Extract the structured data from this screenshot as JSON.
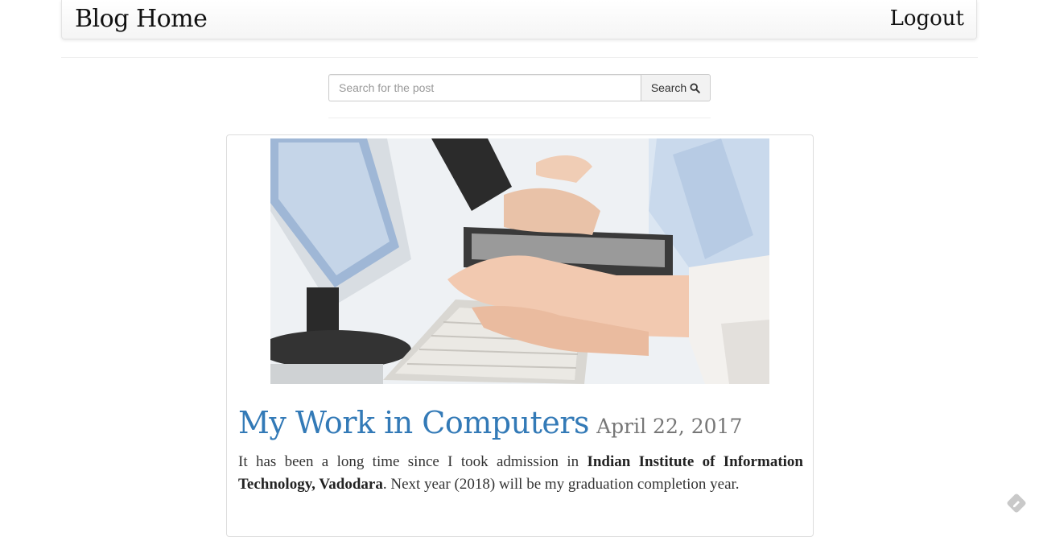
{
  "navbar": {
    "brand": "Blog Home",
    "logout_label": "Logout"
  },
  "search": {
    "placeholder": "Search for the post",
    "button_label": "Search",
    "button_icon": "search-icon"
  },
  "post": {
    "image_description_icon": "post-image",
    "title": "My Work in Computers",
    "date": "April 22, 2017",
    "body_part1": "It has been a long time since I took admission in ",
    "body_bold": "Indian Institute of Information Technology, Vadodara",
    "body_part2": ". Next year (2018) will be my graduation completion year."
  },
  "colors": {
    "link": "#337ab7",
    "muted": "#777777",
    "text": "#333333"
  }
}
